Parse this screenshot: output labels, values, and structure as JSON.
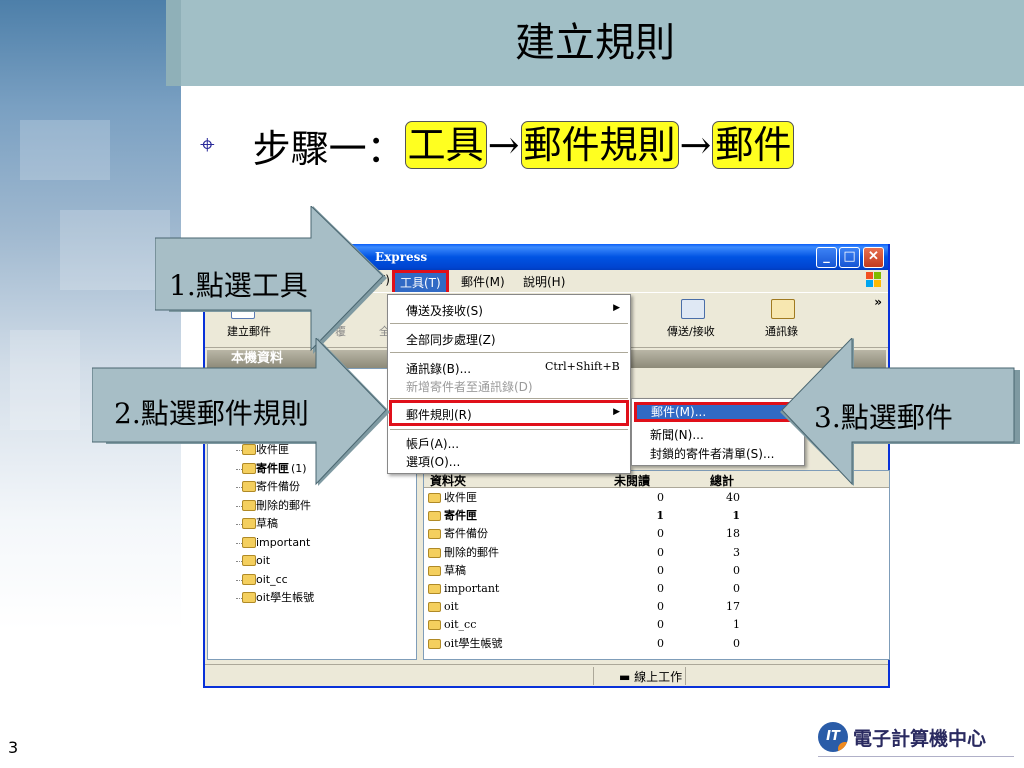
{
  "slide": {
    "title": "建立規則",
    "step_prefix": "步驟一：",
    "step_parts": [
      "工具",
      "郵件規則",
      "郵件"
    ],
    "arrow": "→",
    "page_number": "3",
    "logo_mark": "IT",
    "logo_text": "電子計算機中心"
  },
  "window": {
    "title": "Express",
    "menubar": {
      "partial": "V)",
      "tools": "工具(T)",
      "mail": "郵件(M)",
      "help": "說明(H)"
    },
    "toolbar": {
      "compose": "建立郵件",
      "reply_partial": "覆",
      "all_partial": "全",
      "send_receive": "傳送/接收",
      "addresses": "通訊錄",
      "more": "»"
    },
    "folder_bar_partial": "本機資料",
    "status": "線上工作"
  },
  "tools_menu": {
    "items": [
      {
        "label": "傳送及接收(S)",
        "shortcut": "",
        "submenu": true,
        "disabled": false
      },
      {
        "label": "全部同步處理(Z)",
        "shortcut": "",
        "submenu": false,
        "disabled": false
      },
      {
        "label": "通訊錄(B)...",
        "shortcut": "Ctrl+Shift+B",
        "submenu": false,
        "disabled": false
      },
      {
        "label": "新增寄件者至通訊錄(D)",
        "shortcut": "",
        "submenu": false,
        "disabled": true
      },
      {
        "label": "郵件規則(R)",
        "shortcut": "",
        "submenu": true,
        "disabled": false
      },
      {
        "label": "帳戶(A)...",
        "shortcut": "",
        "submenu": false,
        "disabled": false
      },
      {
        "label": "選項(O)...",
        "shortcut": "",
        "submenu": false,
        "disabled": false
      }
    ]
  },
  "rules_submenu": {
    "items": [
      "郵件(M)...",
      "新聞(N)...",
      "封鎖的寄件者清單(S)..."
    ]
  },
  "folder_tree": [
    {
      "name": "收件匣",
      "bold": false
    },
    {
      "name": "寄件匣",
      "bold": true,
      "suffix": "(1)"
    },
    {
      "name": "寄件備份",
      "bold": false
    },
    {
      "name": "刪除的郵件",
      "bold": false
    },
    {
      "name": "草稿",
      "bold": false
    },
    {
      "name": "important",
      "bold": false
    },
    {
      "name": "oit",
      "bold": false
    },
    {
      "name": "oit_cc",
      "bold": false
    },
    {
      "name": "oit學生帳號",
      "bold": false
    }
  ],
  "folder_grid": {
    "headers": [
      "資料夾",
      "未閱讀",
      "總計"
    ],
    "rows": [
      {
        "name": "收件匣",
        "unread": "0",
        "total": "40",
        "bold": false
      },
      {
        "name": "寄件匣",
        "unread": "1",
        "total": "1",
        "bold": true
      },
      {
        "name": "寄件備份",
        "unread": "0",
        "total": "18",
        "bold": false
      },
      {
        "name": "刪除的郵件",
        "unread": "0",
        "total": "3",
        "bold": false
      },
      {
        "name": "草稿",
        "unread": "0",
        "total": "0",
        "bold": false
      },
      {
        "name": "important",
        "unread": "0",
        "total": "0",
        "bold": false
      },
      {
        "name": "oit",
        "unread": "0",
        "total": "17",
        "bold": false
      },
      {
        "name": "oit_cc",
        "unread": "0",
        "total": "1",
        "bold": false
      },
      {
        "name": "oit學生帳號",
        "unread": "0",
        "total": "0",
        "bold": false
      }
    ]
  },
  "callouts": {
    "c1": "1.點選工具",
    "c2": "2.點選郵件規則",
    "c3": "3.點選郵件"
  },
  "colors": {
    "highlight": "#ffff20",
    "red_box": "#e0101a",
    "selection": "#316ac5",
    "title_band": "#a1bfc6",
    "callout_arrow": "#a7bec6"
  }
}
